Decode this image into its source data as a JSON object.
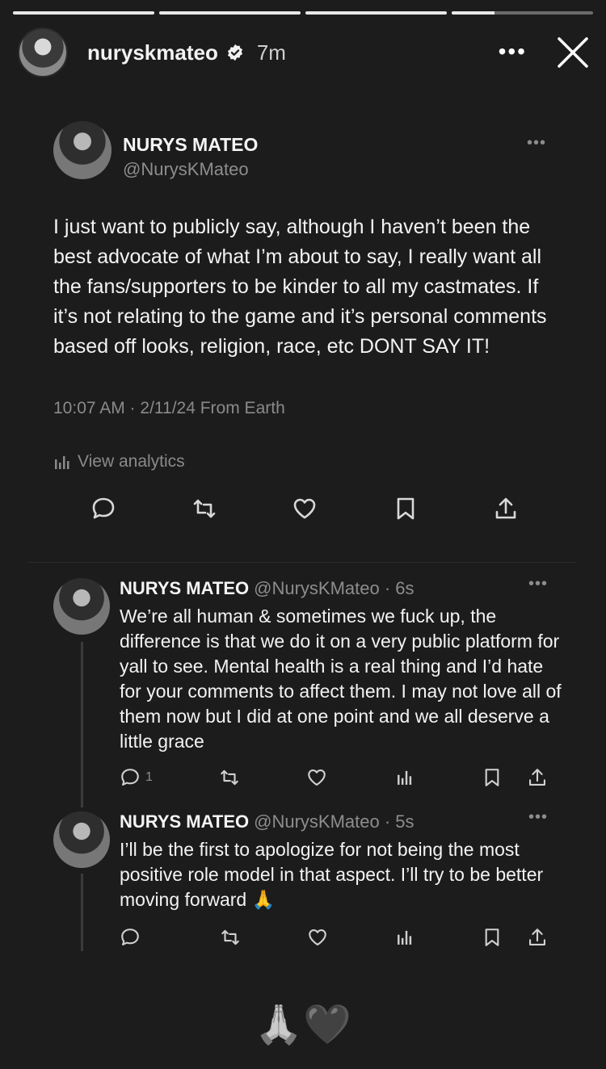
{
  "story": {
    "progress_segments": [
      1,
      1,
      1,
      0.3
    ],
    "username": "nuryskmateo",
    "time": "7m",
    "more_label": "•••"
  },
  "tweet": {
    "display_name": "NURYS MATEO",
    "handle": "@NurysKMateo",
    "text": "I just want to publicly say, although I haven’t been the best advocate of what I’m about to say, I really want all the fans/supporters to be kinder to all my castmates. If it’s not relating to the game and it’s personal comments based off looks, religion, race, etc DONT SAY IT!",
    "timestamp": "10:07 AM · 2/11/24 From Earth",
    "analytics_label": "View analytics",
    "more": "•••"
  },
  "replies": [
    {
      "display_name": "NURYS MATEO",
      "handle": "@NurysKMateo · 6s",
      "text": "We’re all human & sometimes we fuck up, the difference is that we do it on a very public platform for yall to see. Mental health is a real thing and I’d hate for your comments to affect them. I may not love all of them now but I did at one point and we all deserve a little grace",
      "reply_count": "1",
      "more": "•••"
    },
    {
      "display_name": "NURYS MATEO",
      "handle": "@NurysKMateo · 5s",
      "text": "I’ll be the first to apologize for not being the most positive role model in that aspect. I’ll try to be better moving forward 🙏",
      "reply_count": "",
      "more": "•••"
    }
  ],
  "footer": {
    "emojis": "🙏🖤"
  }
}
